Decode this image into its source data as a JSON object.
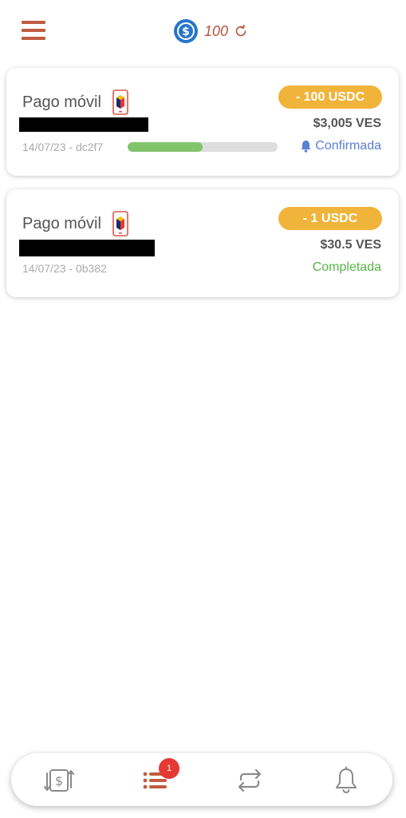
{
  "header": {
    "balance": "100"
  },
  "transactions": [
    {
      "method": "Pago móvil",
      "amount": "- 100 USDC",
      "ves": "$3,005 VES",
      "meta": "14/07/23 - dc2f7",
      "progress": 0.5,
      "status": "Confirmada"
    },
    {
      "method": "Pago móvil",
      "amount": "- 1 USDC",
      "ves": "$30.5 VES",
      "meta": "14/07/23 - 0b382",
      "status": "Completada"
    }
  ],
  "bottom_nav": {
    "items": [
      "exchange-icon",
      "list-icon",
      "swap-icon",
      "bell-icon"
    ],
    "badge": "1"
  },
  "colors": {
    "accent": "#b5533c",
    "pill": "#f0b43a",
    "confirmed": "#5b7fd3",
    "completed": "#57b346",
    "progress": "#82c46c",
    "badge": "#e53935"
  }
}
